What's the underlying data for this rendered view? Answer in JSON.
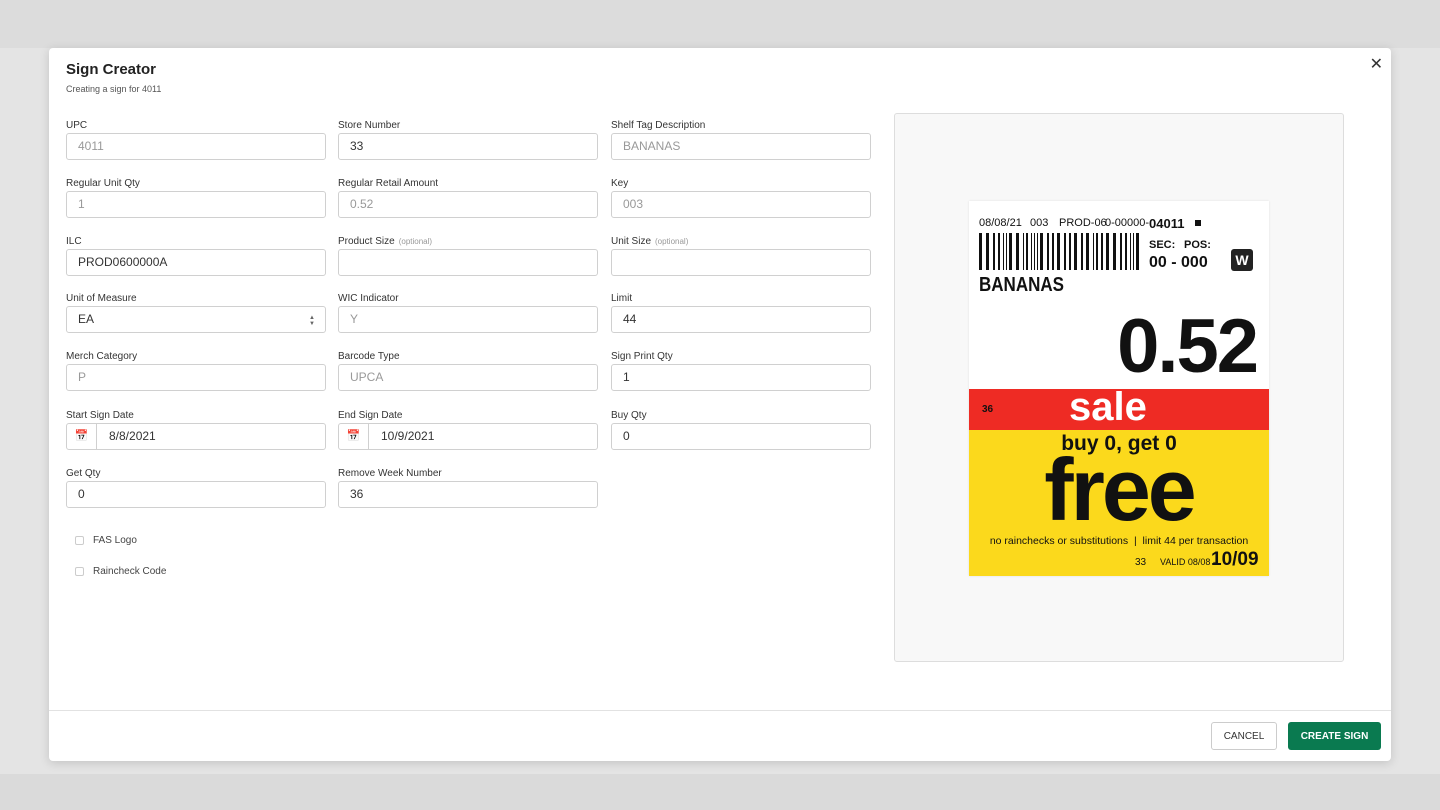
{
  "modal": {
    "title": "Sign Creator",
    "subtitle": "Creating a sign for 4011",
    "close": "✕"
  },
  "fields": [
    {
      "label": "UPC",
      "value": "4011",
      "disabled": true
    },
    {
      "label": "Store Number",
      "value": "33",
      "disabled": false
    },
    {
      "label": "Shelf Tag Description",
      "value": "BANANAS",
      "disabled": true
    },
    {
      "label": "Regular Unit Qty",
      "value": "1",
      "disabled": true
    },
    {
      "label": "Regular Retail Amount",
      "value": "0.52",
      "disabled": true
    },
    {
      "label": "Key",
      "value": "003",
      "disabled": true
    },
    {
      "label": "ILC",
      "value": "PROD0600000A",
      "disabled": false
    },
    {
      "label": "Product Size",
      "optional": "(optional)",
      "value": "",
      "disabled": false
    },
    {
      "label": "Unit Size",
      "optional": "(optional)",
      "value": "",
      "disabled": false
    },
    {
      "label": "Unit of Measure",
      "value": "EA",
      "select": true
    },
    {
      "label": "WIC Indicator",
      "value": "Y",
      "disabled": true
    },
    {
      "label": "Limit",
      "value": "44",
      "disabled": false
    },
    {
      "label": "Merch Category",
      "value": "P",
      "disabled": true
    },
    {
      "label": "Barcode Type",
      "value": "UPCA",
      "disabled": true
    },
    {
      "label": "Sign Print Qty",
      "value": "1",
      "disabled": false
    },
    {
      "label": "Start Sign Date",
      "value": "8/8/2021",
      "date": true
    },
    {
      "label": "End Sign Date",
      "value": "10/9/2021",
      "date": true
    },
    {
      "label": "Buy Qty",
      "value": "0",
      "disabled": false
    },
    {
      "label": "Get Qty",
      "value": "0",
      "disabled": false
    },
    {
      "label": "Remove Week Number",
      "value": "36",
      "disabled": false
    }
  ],
  "checkboxes": [
    {
      "label": "FAS Logo",
      "checked": false
    },
    {
      "label": "Raincheck Code",
      "checked": false
    }
  ],
  "sign": {
    "date": "08/08/21",
    "key": "003",
    "ilc": "PROD-06",
    "upc_prefix": "0-00000-",
    "upc": "04011",
    "sec_label": "SEC:",
    "pos_label": "POS:",
    "secpos": "00 - 000",
    "wic": "W",
    "desc": "BANANAS",
    "price": "0.52",
    "week": "36",
    "sale": "sale",
    "buyget": "buy 0, get 0",
    "free": "free",
    "disclaimer": "no rainchecks or substitutions  |  limit 44 per transaction",
    "store": "33",
    "valid": "VALID 08/08 -",
    "end": "10/09",
    "colors": {
      "red": "#ee2b24",
      "yellow": "#fbd91c"
    }
  },
  "footer": {
    "cancel": "CANCEL",
    "create": "CREATE SIGN"
  },
  "colors": {
    "accent": "#0a7a50"
  }
}
